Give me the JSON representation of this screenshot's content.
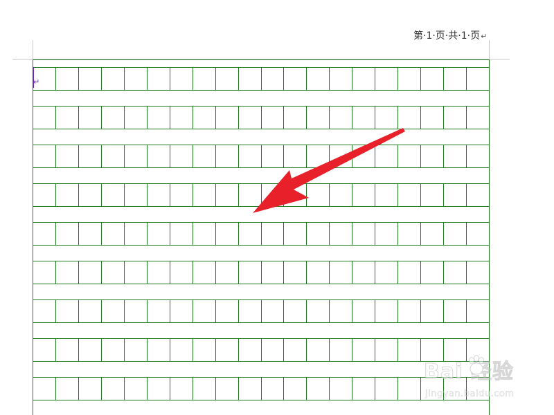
{
  "page_header": {
    "text": "第·1·页·共·1·页",
    "paragraph_mark": "↵"
  },
  "document": {
    "paragraph_mark": "↵",
    "grid": {
      "columns": 20,
      "visible_rows": 9,
      "color": "#1f7a1f"
    }
  },
  "annotation": {
    "type": "arrow",
    "color": "#e8202a"
  },
  "watermark": {
    "text": "Bai 经验",
    "sub_text": "jingyan.baidu.com"
  }
}
